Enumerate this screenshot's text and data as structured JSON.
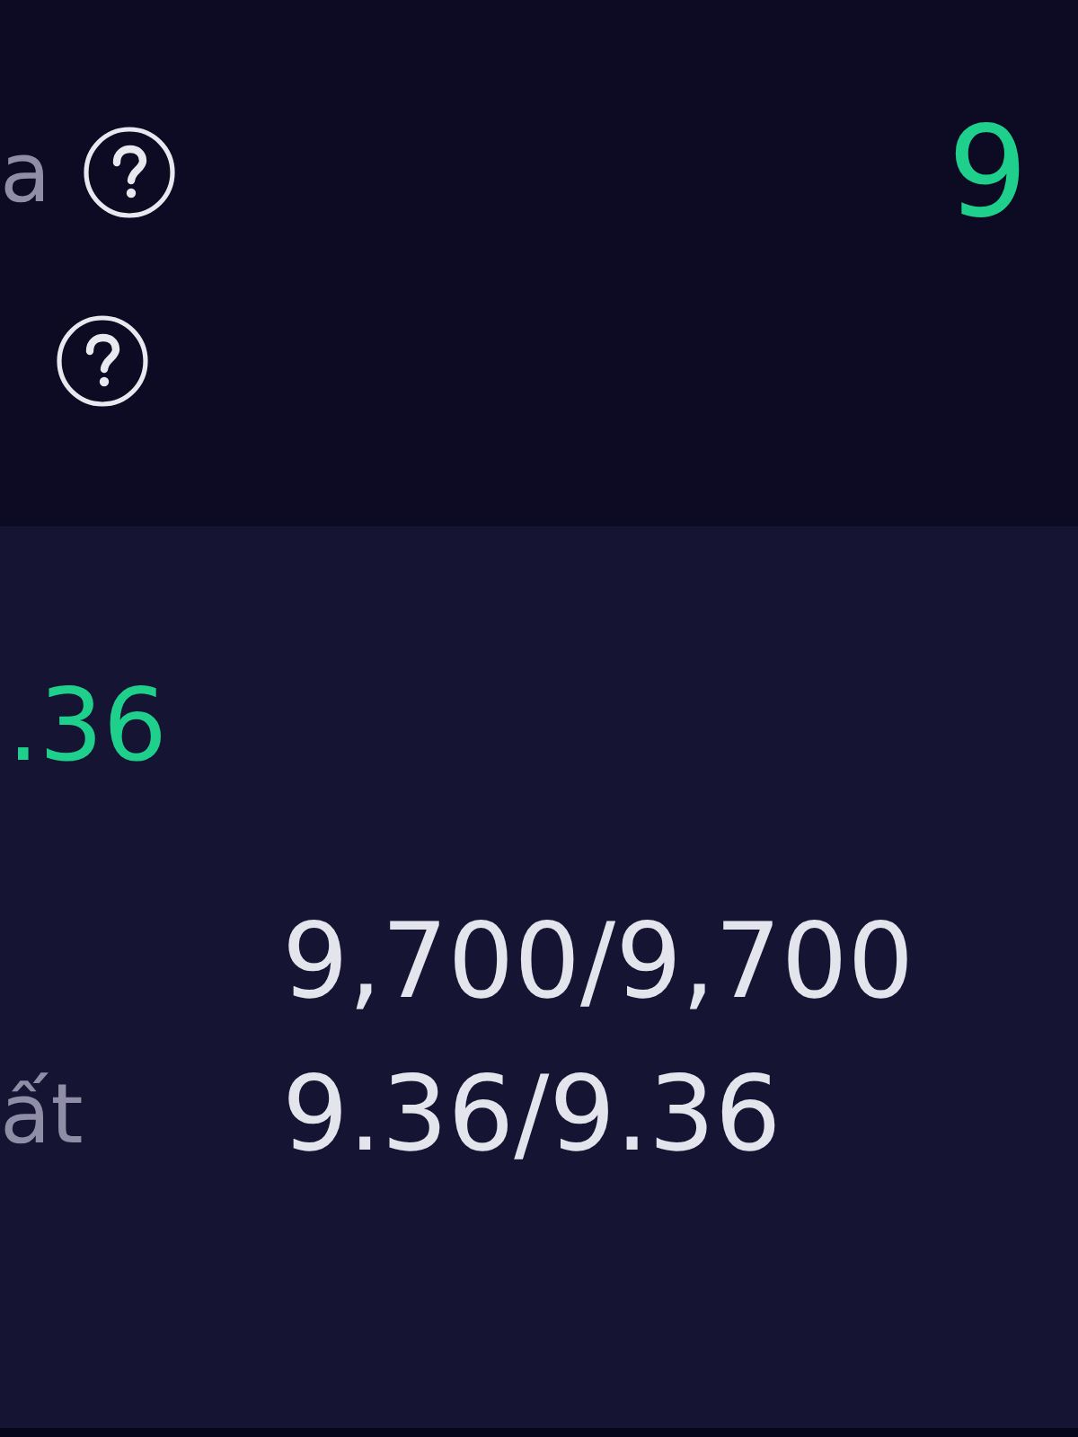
{
  "top": {
    "rows": [
      {
        "label": "a",
        "has_help": true,
        "value": "9"
      },
      {
        "has_help": true
      }
    ]
  },
  "panel": {
    "price": ".36",
    "details": [
      {
        "value": "9,700/9,700"
      },
      {
        "label": "ất",
        "value": "9.36/9.36"
      }
    ]
  }
}
